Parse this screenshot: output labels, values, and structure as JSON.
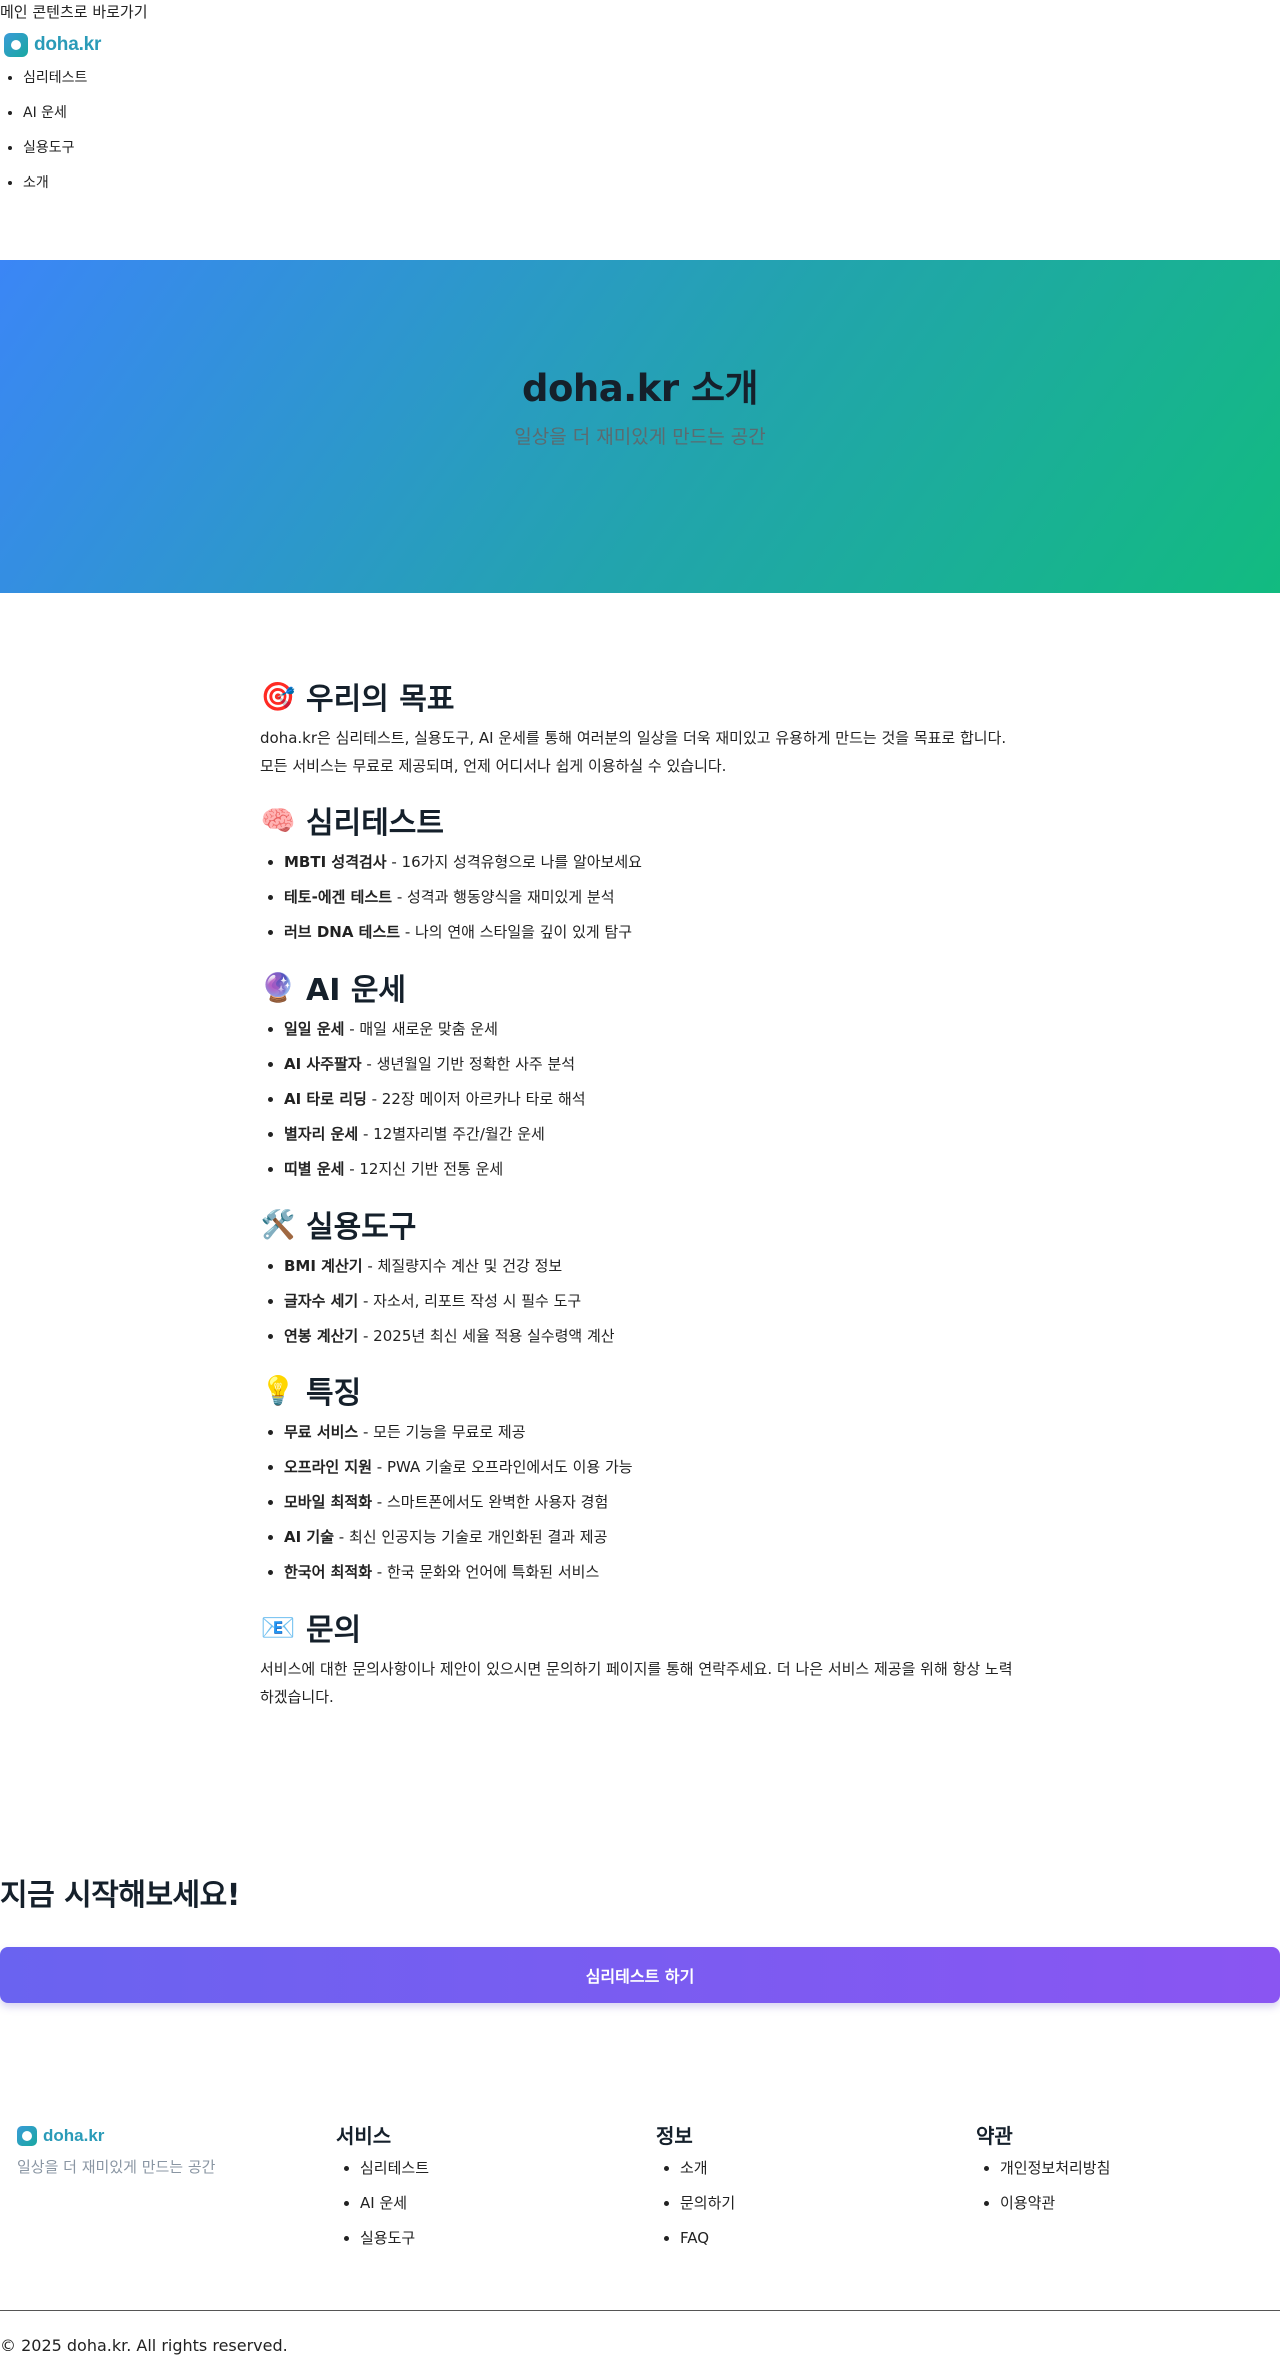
{
  "skip_link": "메인 콘텐츠로 바로가기",
  "brand": {
    "name": "doha.kr"
  },
  "nav": {
    "items": [
      "심리테스트",
      "AI 운세",
      "실용도구",
      "소개"
    ]
  },
  "hero": {
    "title": "doha.kr 소개",
    "subtitle": "일상을 더 재미있게 만드는 공간"
  },
  "sections": {
    "goal": {
      "emoji": "🎯",
      "title": "우리의 목표",
      "text": "doha.kr은 심리테스트, 실용도구, AI 운세를 통해 여러분의 일상을 더욱 재미있고 유용하게 만드는 것을 목표로 합니다. 모든 서비스는 무료로 제공되며, 언제 어디서나 쉽게 이용하실 수 있습니다."
    },
    "psych": {
      "emoji": "🧠",
      "title": "심리테스트",
      "items": [
        {
          "name": "MBTI 성격검사",
          "desc": " - 16가지 성격유형으로 나를 알아보세요"
        },
        {
          "name": "테토-에겐 테스트",
          "desc": " - 성격과 행동양식을 재미있게 분석"
        },
        {
          "name": "러브 DNA 테스트",
          "desc": " - 나의 연애 스타일을 깊이 있게 탐구"
        }
      ]
    },
    "fortune": {
      "emoji": "🔮",
      "title": "AI 운세",
      "items": [
        {
          "name": "일일 운세",
          "desc": " - 매일 새로운 맞춤 운세"
        },
        {
          "name": "AI 사주팔자",
          "desc": " - 생년월일 기반 정확한 사주 분석"
        },
        {
          "name": "AI 타로 리딩",
          "desc": " - 22장 메이저 아르카나 타로 해석"
        },
        {
          "name": "별자리 운세",
          "desc": " - 12별자리별 주간/월간 운세"
        },
        {
          "name": "띠별 운세",
          "desc": " - 12지신 기반 전통 운세"
        }
      ]
    },
    "tools": {
      "emoji": "🛠️",
      "title": "실용도구",
      "items": [
        {
          "name": "BMI 계산기",
          "desc": " - 체질량지수 계산 및 건강 정보"
        },
        {
          "name": "글자수 세기",
          "desc": " - 자소서, 리포트 작성 시 필수 도구"
        },
        {
          "name": "연봉 계산기",
          "desc": " - 2025년 최신 세율 적용 실수령액 계산"
        }
      ]
    },
    "features": {
      "emoji": "💡",
      "title": "특징",
      "items": [
        {
          "name": "무료 서비스",
          "desc": " - 모든 기능을 무료로 제공"
        },
        {
          "name": "오프라인 지원",
          "desc": " - PWA 기술로 오프라인에서도 이용 가능"
        },
        {
          "name": "모바일 최적화",
          "desc": " - 스마트폰에서도 완벽한 사용자 경험"
        },
        {
          "name": "AI 기술",
          "desc": " - 최신 인공지능 기술로 개인화된 결과 제공"
        },
        {
          "name": "한국어 최적화",
          "desc": " - 한국 문화와 언어에 특화된 서비스"
        }
      ]
    },
    "contact": {
      "emoji": "📧",
      "title": "문의",
      "text": "서비스에 대한 문의사항이나 제안이 있으시면 문의하기 페이지를 통해 연락주세요. 더 나은 서비스 제공을 위해 항상 노력하겠습니다."
    }
  },
  "cta": {
    "title": "지금 시작해보세요!",
    "button": "심리테스트 하기"
  },
  "footer": {
    "tagline": "일상을 더 재미있게 만드는 공간",
    "columns": [
      {
        "title": "서비스",
        "links": [
          "심리테스트",
          "AI 운세",
          "실용도구"
        ]
      },
      {
        "title": "정보",
        "links": [
          "소개",
          "문의하기",
          "FAQ"
        ]
      },
      {
        "title": "약관",
        "links": [
          "개인정보처리방침",
          "이용약관"
        ]
      }
    ],
    "copyright": "© 2025 doha.kr. All rights reserved."
  },
  "colors": {
    "brand": "#2a9bb8",
    "hero_start": "#3b86f6",
    "hero_end": "#12bb80",
    "cta_start": "#6a63f0",
    "cta_end": "#8a55f2"
  }
}
